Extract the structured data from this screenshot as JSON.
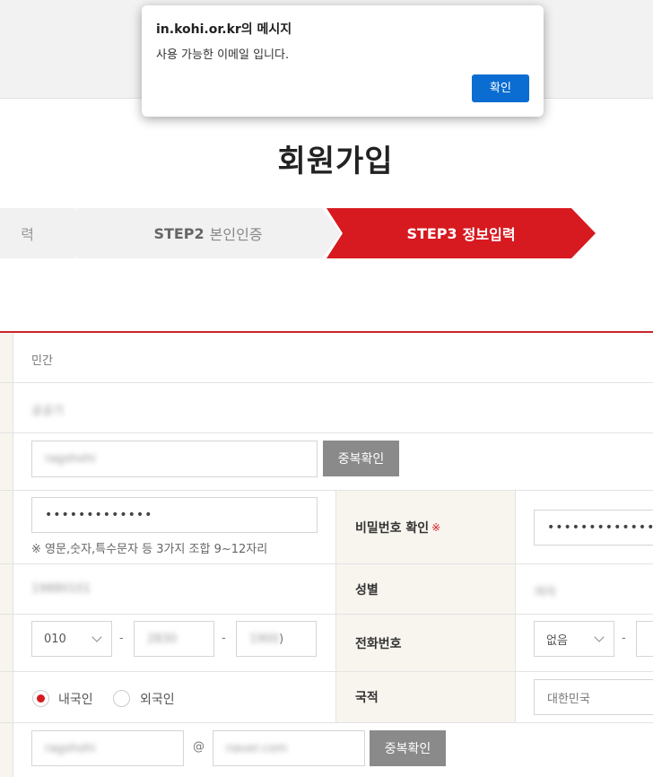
{
  "dialog": {
    "title": "in.kohi.or.kr의 메시지",
    "message": "사용 가능한 이메일 입니다.",
    "ok_label": "확인"
  },
  "page_title": "회원가입",
  "steps": [
    {
      "num": "",
      "name": "력"
    },
    {
      "num": "STEP2",
      "name": "본인인증"
    },
    {
      "num": "STEP3",
      "name": "정보입력"
    }
  ],
  "form": {
    "org_type": "민간",
    "org_name": "공공기",
    "user_id": "ragshohi",
    "dup_check_label": "중복확인",
    "password_value": "•••••••••••••",
    "password_hint": "※ 영문,숫자,특수문자 등 3가지 조합 9~12자리",
    "password_confirm_label": "비밀번호 확인",
    "required_mark": "※",
    "password_confirm_value": "•••••••••••••",
    "birth": "19880101",
    "gender_label": "성별",
    "gender_value": "여자",
    "phone_prefix": "010",
    "phone_mid": "2830",
    "phone_last": "1900",
    "phone_last_suffix": ")",
    "phone_label": "전화번호",
    "tel_prefix": "없음",
    "nationality_label": "국적",
    "nationality_value": "대한민국",
    "radio_domestic": "내국인",
    "radio_foreign": "외국인",
    "email_id": "ragshohi",
    "email_at": "@",
    "email_domain": "naver.com",
    "email_dup_check_label": "중복확인",
    "dash": "-"
  }
}
